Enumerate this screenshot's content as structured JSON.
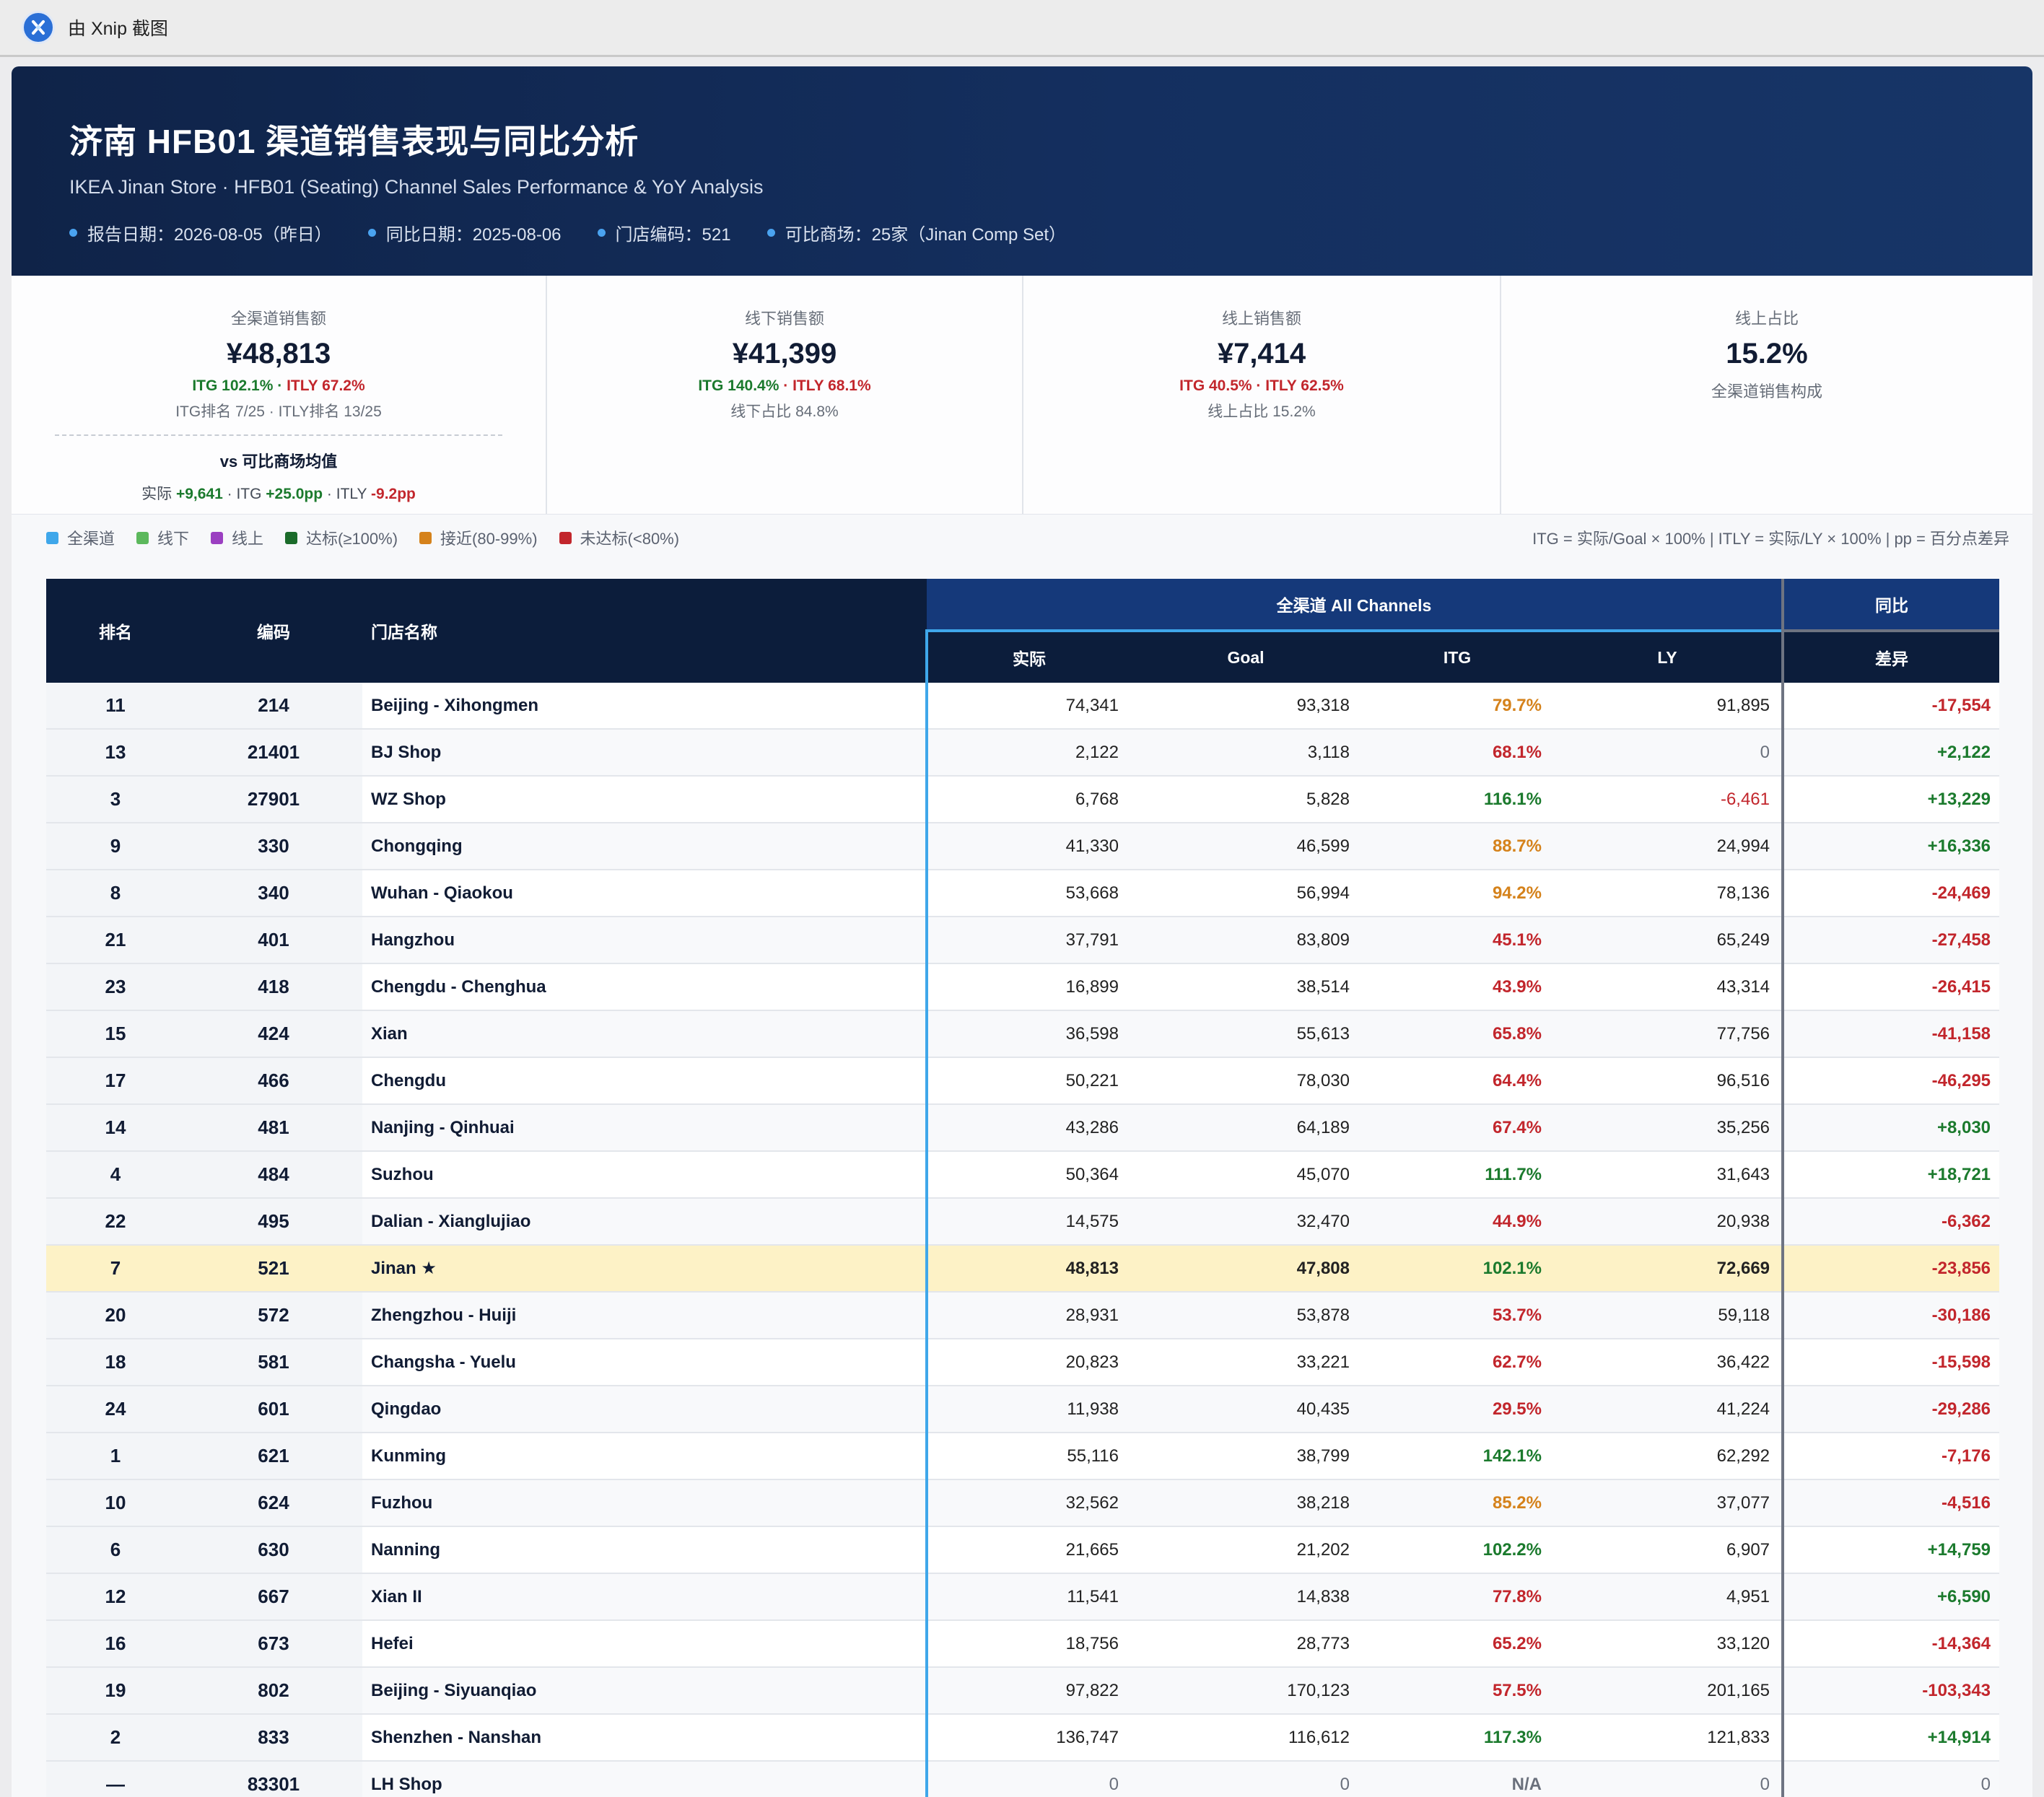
{
  "capture": {
    "label": "由 Xnip 截图"
  },
  "header": {
    "title": "济南 HFB01 渠道销售表现与同比分析",
    "subtitle": "IKEA Jinan Store · HFB01 (Seating) Channel Sales Performance & YoY Analysis",
    "meta": [
      "报告日期：2026-08-05（昨日）",
      "同比日期：2025-08-06",
      "门店编码：521",
      "可比商场：25家（Jinan Comp Set）"
    ]
  },
  "kpis": {
    "total": {
      "label": "全渠道销售额",
      "value": "¥48,813",
      "itg": "ITG 102.1%",
      "sep": " · ",
      "itly": "ITLY 67.2%",
      "rank": "ITG排名 7/25 · ITLY排名 13/25",
      "vs_title": "vs 可比商场均值",
      "vs_actual_label": "实际 ",
      "vs_actual": "+9,641",
      "vs_itg_label": " · ITG ",
      "vs_itg": "+25.0pp",
      "vs_itly_label": " · ITLY ",
      "vs_itly": "-9.2pp"
    },
    "offline": {
      "label": "线下销售额",
      "value": "¥41,399",
      "itg": "ITG 140.4%",
      "sep": " · ",
      "itly": "ITLY 68.1%",
      "note": "线下占比 84.8%"
    },
    "online": {
      "label": "线上销售额",
      "value": "¥7,414",
      "itg": "ITG 40.5%",
      "sep": " · ",
      "itly": "ITLY 62.5%",
      "note": "线上占比 15.2%"
    },
    "share": {
      "label": "线上占比",
      "value": "15.2%",
      "note": "全渠道销售构成"
    }
  },
  "legend": {
    "items": [
      {
        "label": "全渠道",
        "color": "#3fa7ea"
      },
      {
        "label": "线下",
        "color": "#5cb85c"
      },
      {
        "label": "线上",
        "color": "#9b3fc1"
      },
      {
        "label": "达标(≥100%)",
        "color": "#1b6b2a"
      },
      {
        "label": "接近(80-99%)",
        "color": "#d5821b"
      },
      {
        "label": "未达标(<80%)",
        "color": "#c2262c"
      }
    ],
    "formula": "ITG = 实际/Goal × 100% | ITLY = 实际/LY × 100% | pp = 百分点差异"
  },
  "table": {
    "headers": {
      "rank": "排名",
      "code": "编码",
      "name": "门店名称",
      "group_all": "全渠道 All Channels",
      "group_yoy": "同比",
      "actual": "实际",
      "goal": "Goal",
      "itg": "ITG",
      "ly": "LY",
      "diff": "差异"
    },
    "rows": [
      {
        "rank": "11",
        "code": "214",
        "name": "Beijing - Xihongmen",
        "actual": "74,341",
        "goal": "93,318",
        "itg": "79.7%",
        "itg_level": "o",
        "ly": "91,895",
        "diff": "-17,554"
      },
      {
        "rank": "13",
        "code": "21401",
        "name": "BJ Shop",
        "actual": "2,122",
        "goal": "3,118",
        "itg": "68.1%",
        "itg_level": "r",
        "ly": "0",
        "diff": "+2,122"
      },
      {
        "rank": "3",
        "code": "27901",
        "name": "WZ Shop",
        "actual": "6,768",
        "goal": "5,828",
        "itg": "116.1%",
        "itg_level": "g",
        "ly": "-6,461",
        "diff": "+13,229"
      },
      {
        "rank": "9",
        "code": "330",
        "name": "Chongqing",
        "actual": "41,330",
        "goal": "46,599",
        "itg": "88.7%",
        "itg_level": "o",
        "ly": "24,994",
        "diff": "+16,336"
      },
      {
        "rank": "8",
        "code": "340",
        "name": "Wuhan - Qiaokou",
        "actual": "53,668",
        "goal": "56,994",
        "itg": "94.2%",
        "itg_level": "o",
        "ly": "78,136",
        "diff": "-24,469"
      },
      {
        "rank": "21",
        "code": "401",
        "name": "Hangzhou",
        "actual": "37,791",
        "goal": "83,809",
        "itg": "45.1%",
        "itg_level": "r",
        "ly": "65,249",
        "diff": "-27,458"
      },
      {
        "rank": "23",
        "code": "418",
        "name": "Chengdu - Chenghua",
        "actual": "16,899",
        "goal": "38,514",
        "itg": "43.9%",
        "itg_level": "r",
        "ly": "43,314",
        "diff": "-26,415"
      },
      {
        "rank": "15",
        "code": "424",
        "name": "Xian",
        "actual": "36,598",
        "goal": "55,613",
        "itg": "65.8%",
        "itg_level": "r",
        "ly": "77,756",
        "diff": "-41,158"
      },
      {
        "rank": "17",
        "code": "466",
        "name": "Chengdu",
        "actual": "50,221",
        "goal": "78,030",
        "itg": "64.4%",
        "itg_level": "r",
        "ly": "96,516",
        "diff": "-46,295"
      },
      {
        "rank": "14",
        "code": "481",
        "name": "Nanjing - Qinhuai",
        "actual": "43,286",
        "goal": "64,189",
        "itg": "67.4%",
        "itg_level": "r",
        "ly": "35,256",
        "diff": "+8,030"
      },
      {
        "rank": "4",
        "code": "484",
        "name": "Suzhou",
        "actual": "50,364",
        "goal": "45,070",
        "itg": "111.7%",
        "itg_level": "g",
        "ly": "31,643",
        "diff": "+18,721"
      },
      {
        "rank": "22",
        "code": "495",
        "name": "Dalian - Xianglujiao",
        "actual": "14,575",
        "goal": "32,470",
        "itg": "44.9%",
        "itg_level": "r",
        "ly": "20,938",
        "diff": "-6,362"
      },
      {
        "rank": "7",
        "code": "521",
        "name": "Jinan ★",
        "actual": "48,813",
        "goal": "47,808",
        "itg": "102.1%",
        "itg_level": "g",
        "ly": "72,669",
        "diff": "-23,856",
        "highlight": true
      },
      {
        "rank": "20",
        "code": "572",
        "name": "Zhengzhou - Huiji",
        "actual": "28,931",
        "goal": "53,878",
        "itg": "53.7%",
        "itg_level": "r",
        "ly": "59,118",
        "diff": "-30,186"
      },
      {
        "rank": "18",
        "code": "581",
        "name": "Changsha - Yuelu",
        "actual": "20,823",
        "goal": "33,221",
        "itg": "62.7%",
        "itg_level": "r",
        "ly": "36,422",
        "diff": "-15,598"
      },
      {
        "rank": "24",
        "code": "601",
        "name": "Qingdao",
        "actual": "11,938",
        "goal": "40,435",
        "itg": "29.5%",
        "itg_level": "r",
        "ly": "41,224",
        "diff": "-29,286"
      },
      {
        "rank": "1",
        "code": "621",
        "name": "Kunming",
        "actual": "55,116",
        "goal": "38,799",
        "itg": "142.1%",
        "itg_level": "g",
        "ly": "62,292",
        "diff": "-7,176"
      },
      {
        "rank": "10",
        "code": "624",
        "name": "Fuzhou",
        "actual": "32,562",
        "goal": "38,218",
        "itg": "85.2%",
        "itg_level": "o",
        "ly": "37,077",
        "diff": "-4,516"
      },
      {
        "rank": "6",
        "code": "630",
        "name": "Nanning",
        "actual": "21,665",
        "goal": "21,202",
        "itg": "102.2%",
        "itg_level": "g",
        "ly": "6,907",
        "diff": "+14,759"
      },
      {
        "rank": "12",
        "code": "667",
        "name": "Xian II",
        "actual": "11,541",
        "goal": "14,838",
        "itg": "77.8%",
        "itg_level": "r",
        "ly": "4,951",
        "diff": "+6,590"
      },
      {
        "rank": "16",
        "code": "673",
        "name": "Hefei",
        "actual": "18,756",
        "goal": "28,773",
        "itg": "65.2%",
        "itg_level": "r",
        "ly": "33,120",
        "diff": "-14,364"
      },
      {
        "rank": "19",
        "code": "802",
        "name": "Beijing - Siyuanqiao",
        "actual": "97,822",
        "goal": "170,123",
        "itg": "57.5%",
        "itg_level": "r",
        "ly": "201,165",
        "diff": "-103,343"
      },
      {
        "rank": "2",
        "code": "833",
        "name": "Shenzhen - Nanshan",
        "actual": "136,747",
        "goal": "116,612",
        "itg": "117.3%",
        "itg_level": "g",
        "ly": "121,833",
        "diff": "+14,914"
      },
      {
        "rank": "—",
        "code": "83301",
        "name": "LH Shop",
        "actual": "0",
        "goal": "0",
        "itg": "N/A",
        "itg_level": "z",
        "ly": "0",
        "diff": "0"
      }
    ]
  }
}
